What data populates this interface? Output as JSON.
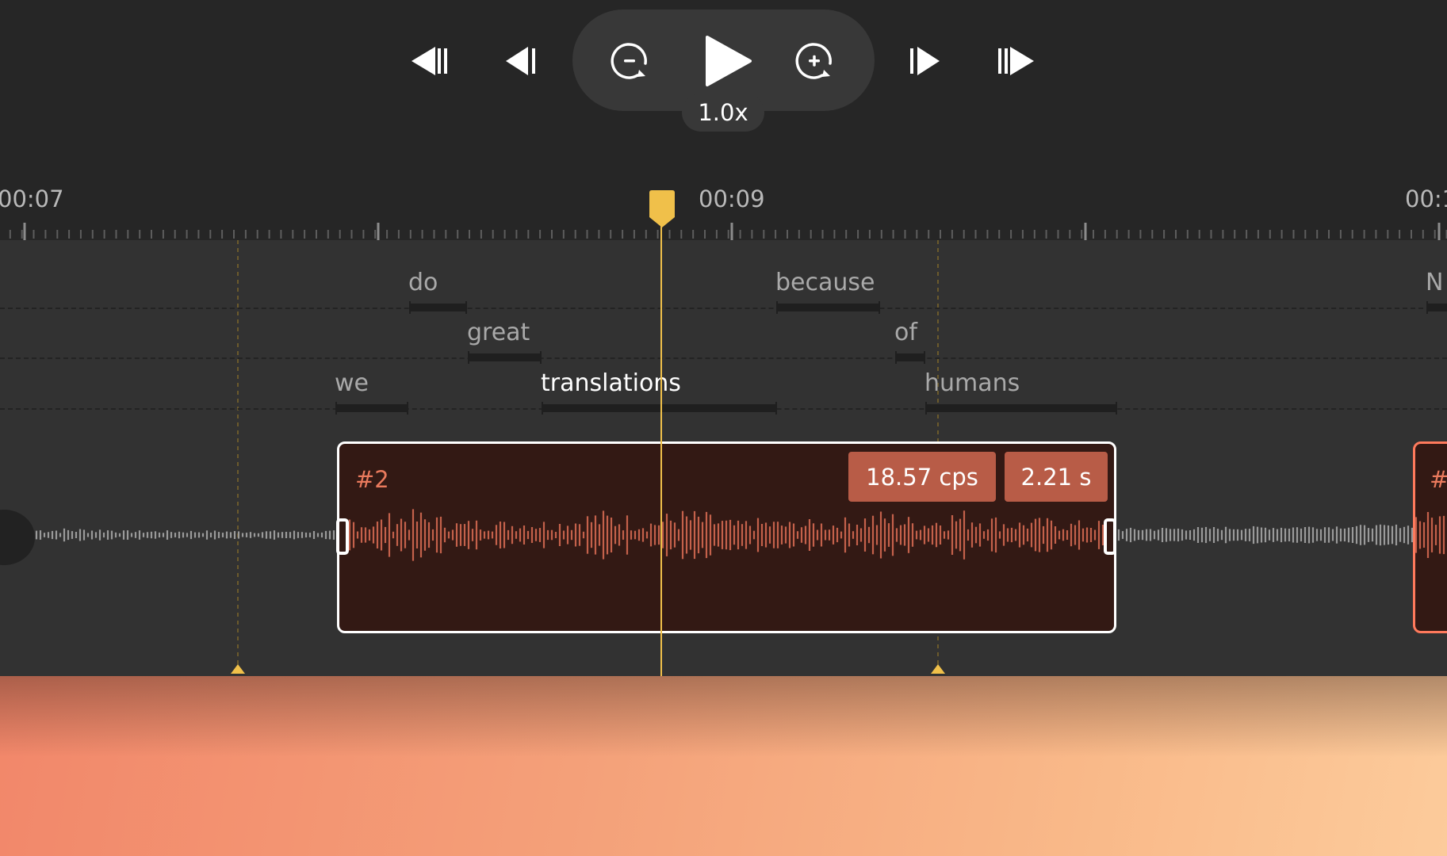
{
  "transport": {
    "speed_label": "1.0x",
    "buttons": [
      {
        "name": "skip-to-previous-segment-button",
        "icon": "skip-back-double-icon"
      },
      {
        "name": "previous-frame-button",
        "icon": "step-back-icon"
      },
      {
        "name": "zoom-out-button",
        "icon": "zoom-out-circle-icon"
      },
      {
        "name": "play-button",
        "icon": "play-icon"
      },
      {
        "name": "zoom-in-button",
        "icon": "zoom-in-circle-icon"
      },
      {
        "name": "next-frame-button",
        "icon": "step-forward-icon"
      },
      {
        "name": "skip-to-next-segment-button",
        "icon": "skip-forward-double-icon"
      }
    ]
  },
  "ruler": {
    "labels": [
      "00:07",
      "00:09",
      "00:1"
    ]
  },
  "words": {
    "do": "do",
    "great": "great",
    "we": "we",
    "translations": "translations",
    "because": "because",
    "of": "of",
    "humans": "humans",
    "next": "N"
  },
  "segment": {
    "index_label": "#2",
    "cps_label": "18.57 cps",
    "duration_label": "2.21 s",
    "next_index_label": "#"
  },
  "colors": {
    "background": "#262626",
    "track": "#323232",
    "accent_yellow": "#f0c04a",
    "segment_fill": "#331914",
    "segment_chip": "#b85c47",
    "waveform_active": "#c4614b",
    "waveform_idle": "#9a9a9a"
  }
}
